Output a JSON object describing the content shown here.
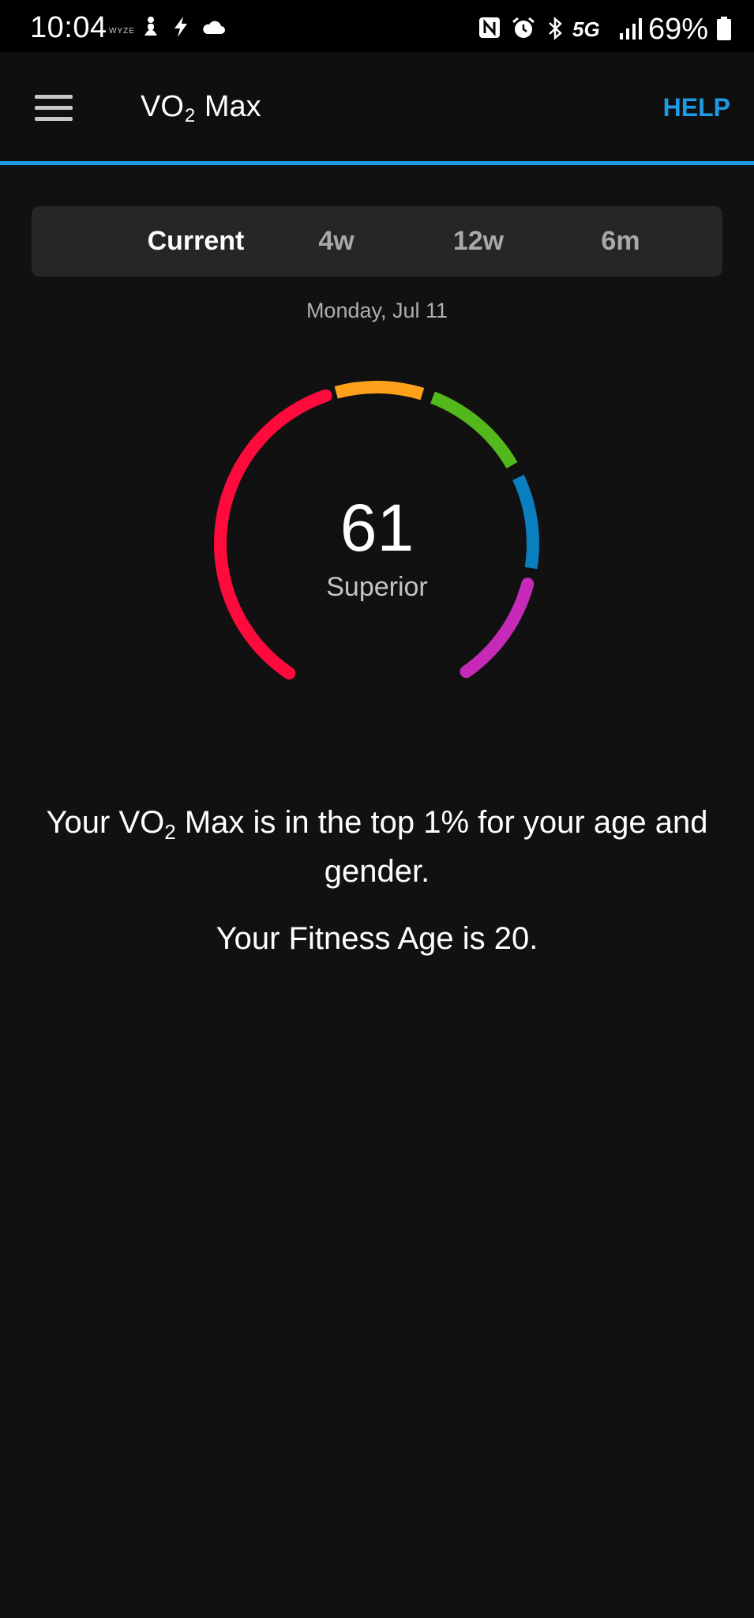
{
  "status_bar": {
    "time": "10:04",
    "small_label": "WYZE",
    "left_icons": [
      "wyze-icon",
      "figure-icon",
      "bolt-icon",
      "cloud-icon"
    ],
    "right_icons": [
      "nfc-icon",
      "alarm-icon",
      "bluetooth-icon",
      "5g-icon",
      "signal-icon"
    ],
    "network": "5G",
    "battery_percent": "69%"
  },
  "app_bar": {
    "title_prefix": "VO",
    "title_sub": "2",
    "title_suffix": " Max",
    "help_label": "HELP",
    "accent_color": "#1e9be6"
  },
  "tabs": [
    {
      "label": "Current",
      "active": true
    },
    {
      "label": "4w",
      "active": false
    },
    {
      "label": "12w",
      "active": false
    },
    {
      "label": "6m",
      "active": false
    }
  ],
  "date": "Monday, Jul 11",
  "gauge": {
    "value": "61",
    "category": "Superior",
    "segment_colors": [
      "#ff0a3c",
      "#ffa11a",
      "#52b81c",
      "#0a7fbf",
      "#c72ab8"
    ]
  },
  "message": {
    "line1_prefix": "Your VO",
    "line1_sub": "2",
    "line1_suffix": " Max is in the top 1% for your age and gender.",
    "fitness_age": "Your Fitness Age is 20."
  }
}
